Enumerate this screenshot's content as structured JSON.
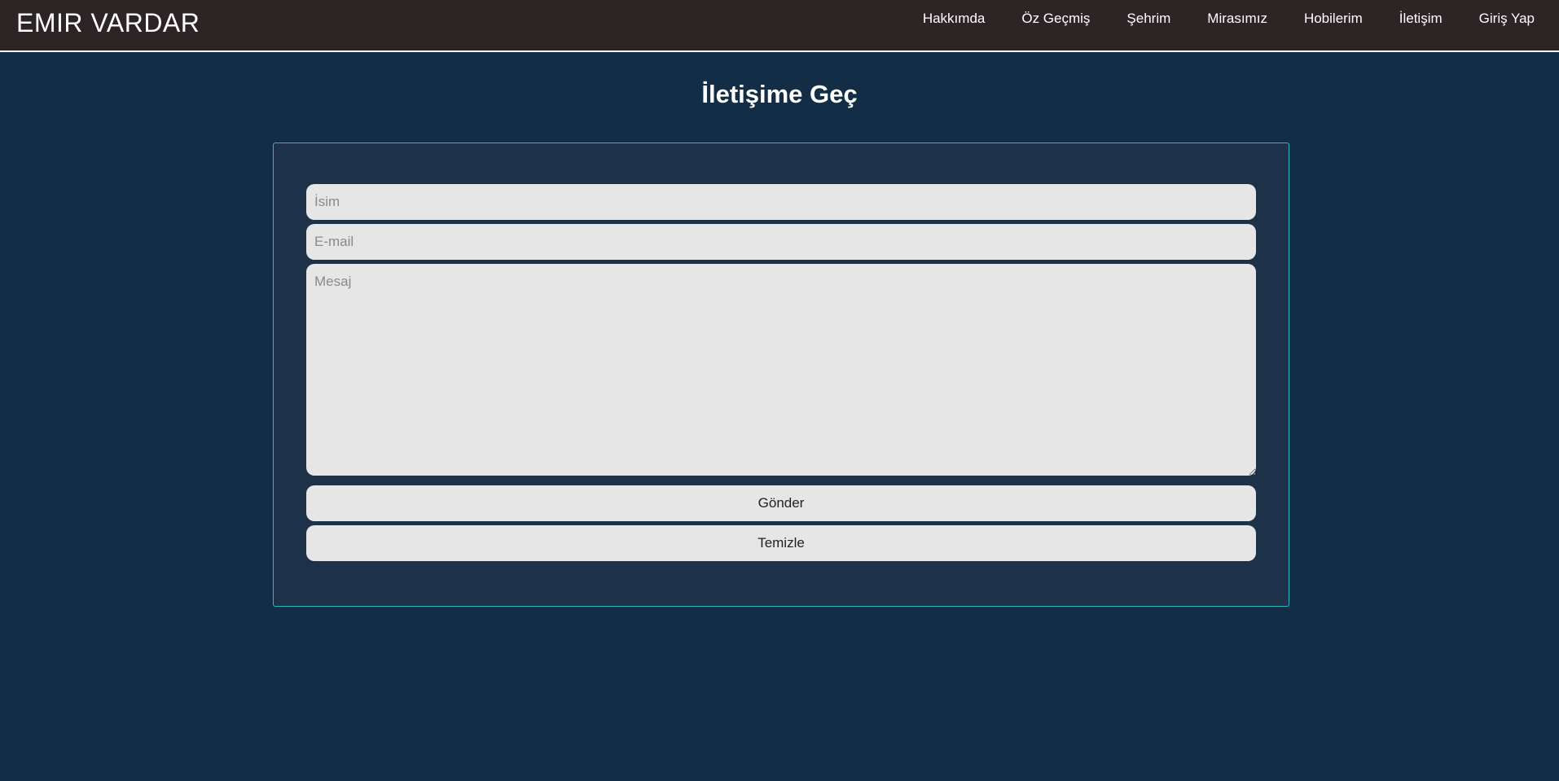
{
  "header": {
    "brand": "EMIR VARDAR",
    "nav": [
      {
        "label": "Hakkımda"
      },
      {
        "label": "Öz Geçmiş"
      },
      {
        "label": "Şehrim"
      },
      {
        "label": "Mirasımız"
      },
      {
        "label": "Hobilerim"
      },
      {
        "label": "İletişim"
      },
      {
        "label": "Giriş Yap"
      }
    ]
  },
  "main": {
    "title": "İletişime Geç",
    "form": {
      "name_placeholder": "İsim",
      "name_value": "",
      "email_placeholder": "E-mail",
      "email_value": "",
      "message_placeholder": "Mesaj",
      "message_value": "",
      "send_label": "Gönder",
      "clear_label": "Temizle"
    }
  },
  "colors": {
    "page_background": "#122d45",
    "navbar_background": "#2d2426",
    "panel_background": "#1d3149",
    "panel_border": "#2ab9c4",
    "field_background": "#e6e6e6"
  }
}
